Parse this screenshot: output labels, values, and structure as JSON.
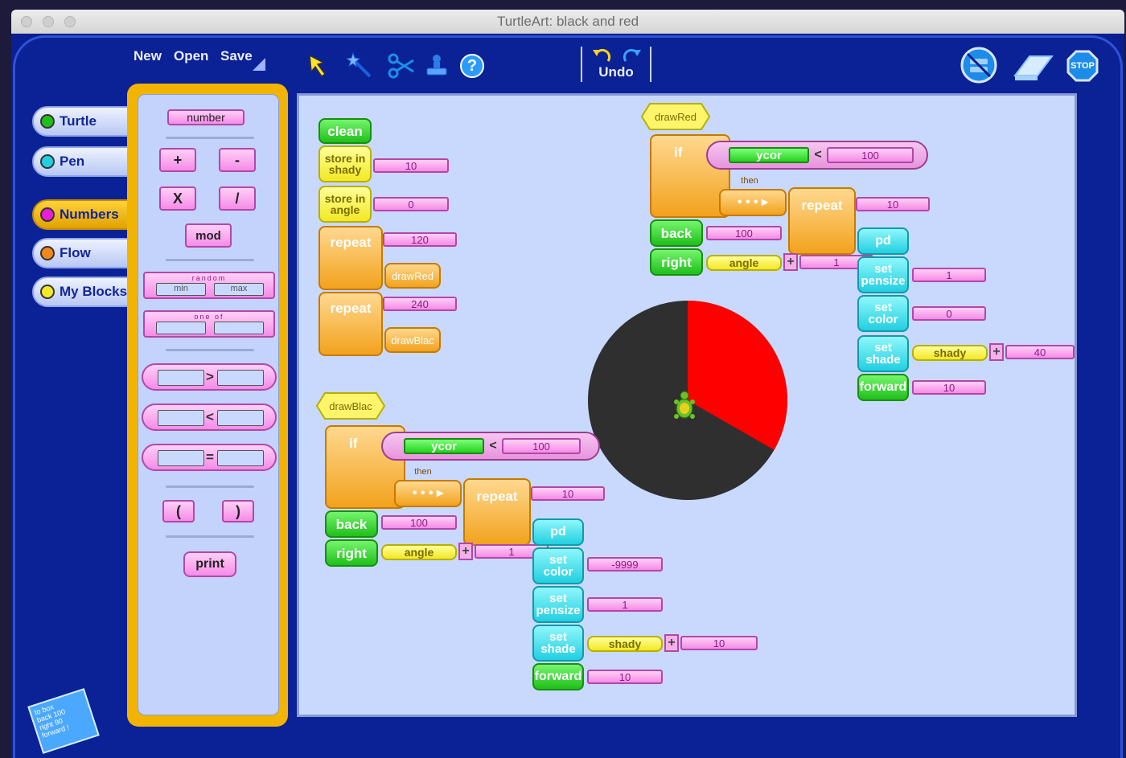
{
  "window": {
    "title": "TurtleArt: black and red"
  },
  "menu": {
    "new": "New",
    "open": "Open",
    "save": "Save"
  },
  "toolbar": {
    "undo": "Undo",
    "help": "?",
    "stop": "STOP"
  },
  "categories": [
    {
      "label": "Turtle",
      "color": "#1fbf1a"
    },
    {
      "label": "Pen",
      "color": "#22cfe0"
    },
    {
      "label": "Numbers",
      "color": "#e71fd9"
    },
    {
      "label": "Flow",
      "color": "#f2881d"
    },
    {
      "label": "My Blocks",
      "color": "#f3e824"
    }
  ],
  "palette": {
    "number": "number",
    "plus": "+",
    "minus": "-",
    "times": "X",
    "divide": "/",
    "mod": "mod",
    "random": "random",
    "min": "min",
    "max": "max",
    "oneof": "one of",
    "gt": ">",
    "lt": "<",
    "eq": "=",
    "lparen": "(",
    "rparen": ")",
    "print": "print"
  },
  "canvas": {
    "clean": "clean",
    "store1": "store in shady",
    "store1_val": "10",
    "store2": "store in angle",
    "store2_val": "0",
    "repeat1": "repeat",
    "repeat1_val": "120",
    "drawRed_call": "drawRed",
    "repeat2": "repeat",
    "repeat2_val": "240",
    "drawBlac_call": "drawBlac",
    "red": {
      "hat": "drawRed",
      "if": "if",
      "ycor": "ycor",
      "lt": "<",
      "cmp": "100",
      "then": "then",
      "repeat": "repeat",
      "repeat_val": "10",
      "back": "back",
      "back_val": "100",
      "right": "right",
      "right_var": "angle",
      "plus": "+",
      "right_add": "1",
      "pd": "pd",
      "set_pensize": "set pensize",
      "pensize_val": "1",
      "set_color": "set color",
      "color_val": "0",
      "set_shade": "set shade",
      "shade_var": "shady",
      "shade_add": "40",
      "forward": "forward",
      "forward_val": "10"
    },
    "black": {
      "hat": "drawBlac",
      "if": "if",
      "ycor": "ycor",
      "lt": "<",
      "cmp": "100",
      "then": "then",
      "repeat": "repeat",
      "repeat_val": "10",
      "back": "back",
      "back_val": "100",
      "right": "right",
      "right_var": "angle",
      "plus": "+",
      "right_add": "1",
      "pd": "pd",
      "set_color": "set color",
      "color_val": "-9999",
      "set_pensize": "set pensize",
      "pensize_val": "1",
      "set_shade": "set shade",
      "shade_var": "shady",
      "shade_add": "10",
      "forward": "forward",
      "forward_val": "10"
    }
  },
  "note": {
    "line1": "to box",
    "line2": "back 100",
    "line3": "right 90",
    "line4": "forward !"
  },
  "drawing": {
    "dark": "#2f2f2f",
    "red": "#ff0000",
    "red_fraction": 0.333
  }
}
